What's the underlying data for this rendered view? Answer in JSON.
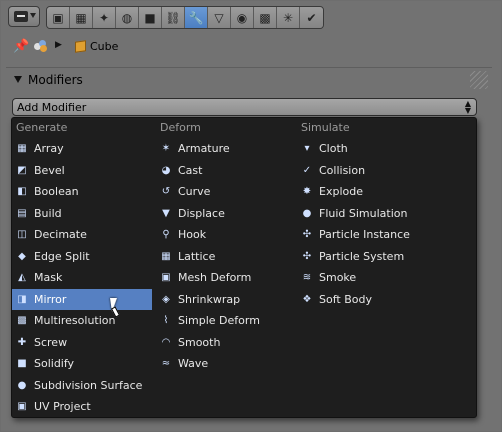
{
  "colors": {
    "highlight": "#5680c2",
    "menu_bg": "#1e1e1e",
    "panel_bg": "#727272",
    "active_tab": "#5a8ccc"
  },
  "header": {
    "editor_type_icon": "editor-type-icon",
    "tabs": [
      {
        "icon": "render-icon",
        "glyph": "▣"
      },
      {
        "icon": "render-layers-icon",
        "glyph": "▦"
      },
      {
        "icon": "scene-icon",
        "glyph": "✦"
      },
      {
        "icon": "world-icon",
        "glyph": "◍"
      },
      {
        "icon": "object-icon",
        "glyph": "■"
      },
      {
        "icon": "constraints-icon",
        "glyph": "⛓"
      },
      {
        "icon": "modifiers-wrench-icon",
        "glyph": "🔧",
        "active": true
      },
      {
        "icon": "data-triangle-icon",
        "glyph": "▽"
      },
      {
        "icon": "material-icon",
        "glyph": "◉"
      },
      {
        "icon": "texture-icon",
        "glyph": "▩"
      },
      {
        "icon": "particles-icon",
        "glyph": "✳"
      },
      {
        "icon": "physics-icon",
        "glyph": "✔"
      }
    ]
  },
  "breadcrumb": {
    "object_name": "Cube"
  },
  "panel": {
    "title": "Modifiers",
    "add_modifier_label": "Add Modifier"
  },
  "menu": {
    "columns": [
      {
        "heading": "Generate",
        "items": [
          {
            "label": "Array",
            "icon": "array-icon"
          },
          {
            "label": "Bevel",
            "icon": "bevel-icon"
          },
          {
            "label": "Boolean",
            "icon": "boolean-icon"
          },
          {
            "label": "Build",
            "icon": "build-icon"
          },
          {
            "label": "Decimate",
            "icon": "decimate-icon"
          },
          {
            "label": "Edge Split",
            "icon": "edge-split-icon"
          },
          {
            "label": "Mask",
            "icon": "mask-icon"
          },
          {
            "label": "Mirror",
            "icon": "mirror-icon",
            "highlighted": true
          },
          {
            "label": "Multiresolution",
            "icon": "multiresolution-icon"
          },
          {
            "label": "Screw",
            "icon": "screw-icon"
          },
          {
            "label": "Solidify",
            "icon": "solidify-icon"
          },
          {
            "label": "Subdivision Surface",
            "icon": "subdivision-surface-icon"
          },
          {
            "label": "UV Project",
            "icon": "uv-project-icon"
          }
        ]
      },
      {
        "heading": "Deform",
        "items": [
          {
            "label": "Armature",
            "icon": "armature-icon"
          },
          {
            "label": "Cast",
            "icon": "cast-icon"
          },
          {
            "label": "Curve",
            "icon": "curve-icon"
          },
          {
            "label": "Displace",
            "icon": "displace-icon"
          },
          {
            "label": "Hook",
            "icon": "hook-icon"
          },
          {
            "label": "Lattice",
            "icon": "lattice-icon"
          },
          {
            "label": "Mesh Deform",
            "icon": "mesh-deform-icon"
          },
          {
            "label": "Shrinkwrap",
            "icon": "shrinkwrap-icon"
          },
          {
            "label": "Simple Deform",
            "icon": "simple-deform-icon"
          },
          {
            "label": "Smooth",
            "icon": "smooth-icon"
          },
          {
            "label": "Wave",
            "icon": "wave-icon"
          }
        ]
      },
      {
        "heading": "Simulate",
        "items": [
          {
            "label": "Cloth",
            "icon": "cloth-icon"
          },
          {
            "label": "Collision",
            "icon": "collision-icon"
          },
          {
            "label": "Explode",
            "icon": "explode-icon"
          },
          {
            "label": "Fluid Simulation",
            "icon": "fluid-simulation-icon"
          },
          {
            "label": "Particle Instance",
            "icon": "particle-instance-icon"
          },
          {
            "label": "Particle System",
            "icon": "particle-system-icon"
          },
          {
            "label": "Smoke",
            "icon": "smoke-icon"
          },
          {
            "label": "Soft Body",
            "icon": "soft-body-icon"
          }
        ]
      }
    ]
  }
}
